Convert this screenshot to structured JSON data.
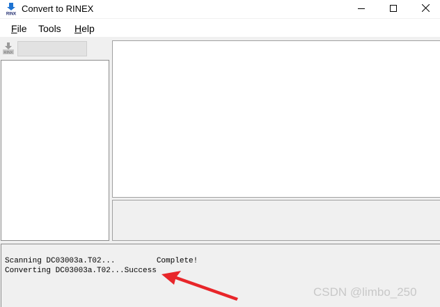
{
  "window": {
    "title": "Convert to RINEX",
    "icon_label": "RINX"
  },
  "menu": [
    {
      "label": "File",
      "mnemonic": "F",
      "rest": "ile"
    },
    {
      "label": "Tools",
      "mnemonic": "",
      "rest": "Tools"
    },
    {
      "label": "Help",
      "mnemonic": "H",
      "rest": "elp"
    }
  ],
  "toolbar": {
    "convert_icon_label": "RINX",
    "field_value": ""
  },
  "log": {
    "lines": [
      "Scanning DC03003a.T02...         Complete!",
      "Converting DC03003a.T02...Success"
    ]
  },
  "watermark": "CSDN @limbo_250",
  "colors": {
    "arrow": "#e8262a",
    "icon_blue": "#1e73d2"
  }
}
